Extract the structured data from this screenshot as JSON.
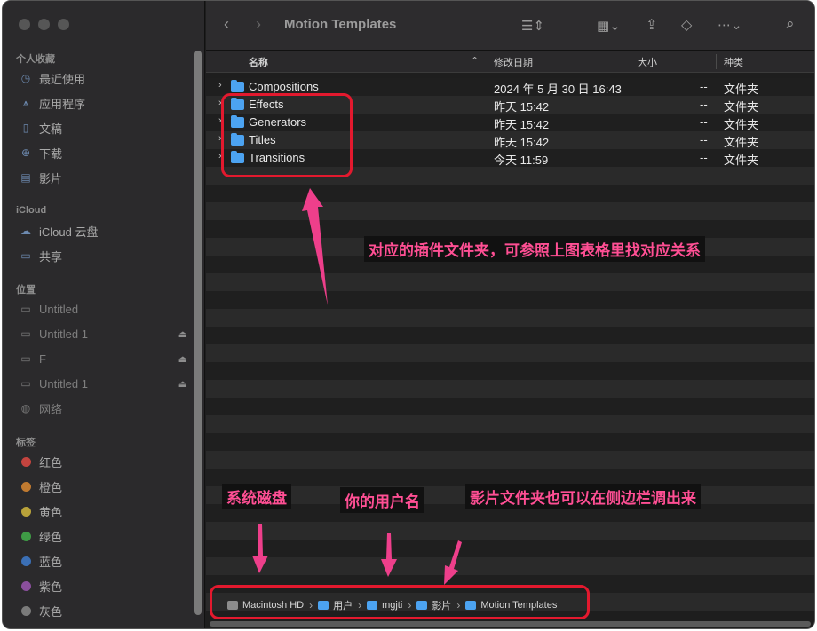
{
  "window": {
    "title": "Motion Templates"
  },
  "sidebar": {
    "favorites_header": "个人收藏",
    "favorites": [
      {
        "label": "最近使用",
        "icon": "clock-icon"
      },
      {
        "label": "应用程序",
        "icon": "apps-icon"
      },
      {
        "label": "文稿",
        "icon": "document-icon"
      },
      {
        "label": "下载",
        "icon": "download-icon"
      },
      {
        "label": "影片",
        "icon": "film-icon"
      }
    ],
    "icloud_header": "iCloud",
    "icloud": [
      {
        "label": "iCloud 云盘",
        "icon": "cloud-icon"
      },
      {
        "label": "共享",
        "icon": "shared-folder-icon"
      }
    ],
    "locations_header": "位置",
    "locations": [
      {
        "label": "Untitled",
        "icon": "disk-icon"
      },
      {
        "label": "Untitled 1",
        "icon": "disk-icon",
        "eject": true
      },
      {
        "label": "F",
        "icon": "disk-icon",
        "eject": true
      },
      {
        "label": "Untitled 1",
        "icon": "disk-icon",
        "eject": true
      },
      {
        "label": "网络",
        "icon": "globe-icon"
      }
    ],
    "tags_header": "标签",
    "tags": [
      {
        "label": "红色",
        "color": "#c4443f"
      },
      {
        "label": "橙色",
        "color": "#c07a30"
      },
      {
        "label": "黄色",
        "color": "#b9a23a"
      },
      {
        "label": "绿色",
        "color": "#3e9a45"
      },
      {
        "label": "蓝色",
        "color": "#3b6fb5"
      },
      {
        "label": "紫色",
        "color": "#8a4f9c"
      },
      {
        "label": "灰色",
        "color": "#7b7b7b"
      }
    ]
  },
  "columns": {
    "name": "名称",
    "date": "修改日期",
    "size": "大小",
    "kind": "种类"
  },
  "files": [
    {
      "name": "Compositions",
      "date": "2024 年 5 月 30 日 16:43",
      "size": "--",
      "kind": "文件夹"
    },
    {
      "name": "Effects",
      "date": "昨天 15:42",
      "size": "--",
      "kind": "文件夹"
    },
    {
      "name": "Generators",
      "date": "昨天 15:42",
      "size": "--",
      "kind": "文件夹"
    },
    {
      "name": "Titles",
      "date": "昨天 15:42",
      "size": "--",
      "kind": "文件夹"
    },
    {
      "name": "Transitions",
      "date": "今天 11:59",
      "size": "--",
      "kind": "文件夹"
    }
  ],
  "pathbar": [
    "Macintosh HD",
    "用户",
    "mgjti",
    "影片",
    "Motion Templates"
  ],
  "annotations": {
    "plugin_note": "对应的插件文件夹，可参照上图表格里找对应关系",
    "disk_note": "系统磁盘",
    "user_note": "你的用户名",
    "movies_note": "影片文件夹也可以在侧边栏调出来"
  },
  "colors": {
    "accent": "#4ca3f1",
    "annotation_red": "#e3192e",
    "annotation_pink": "#ff4f94"
  }
}
